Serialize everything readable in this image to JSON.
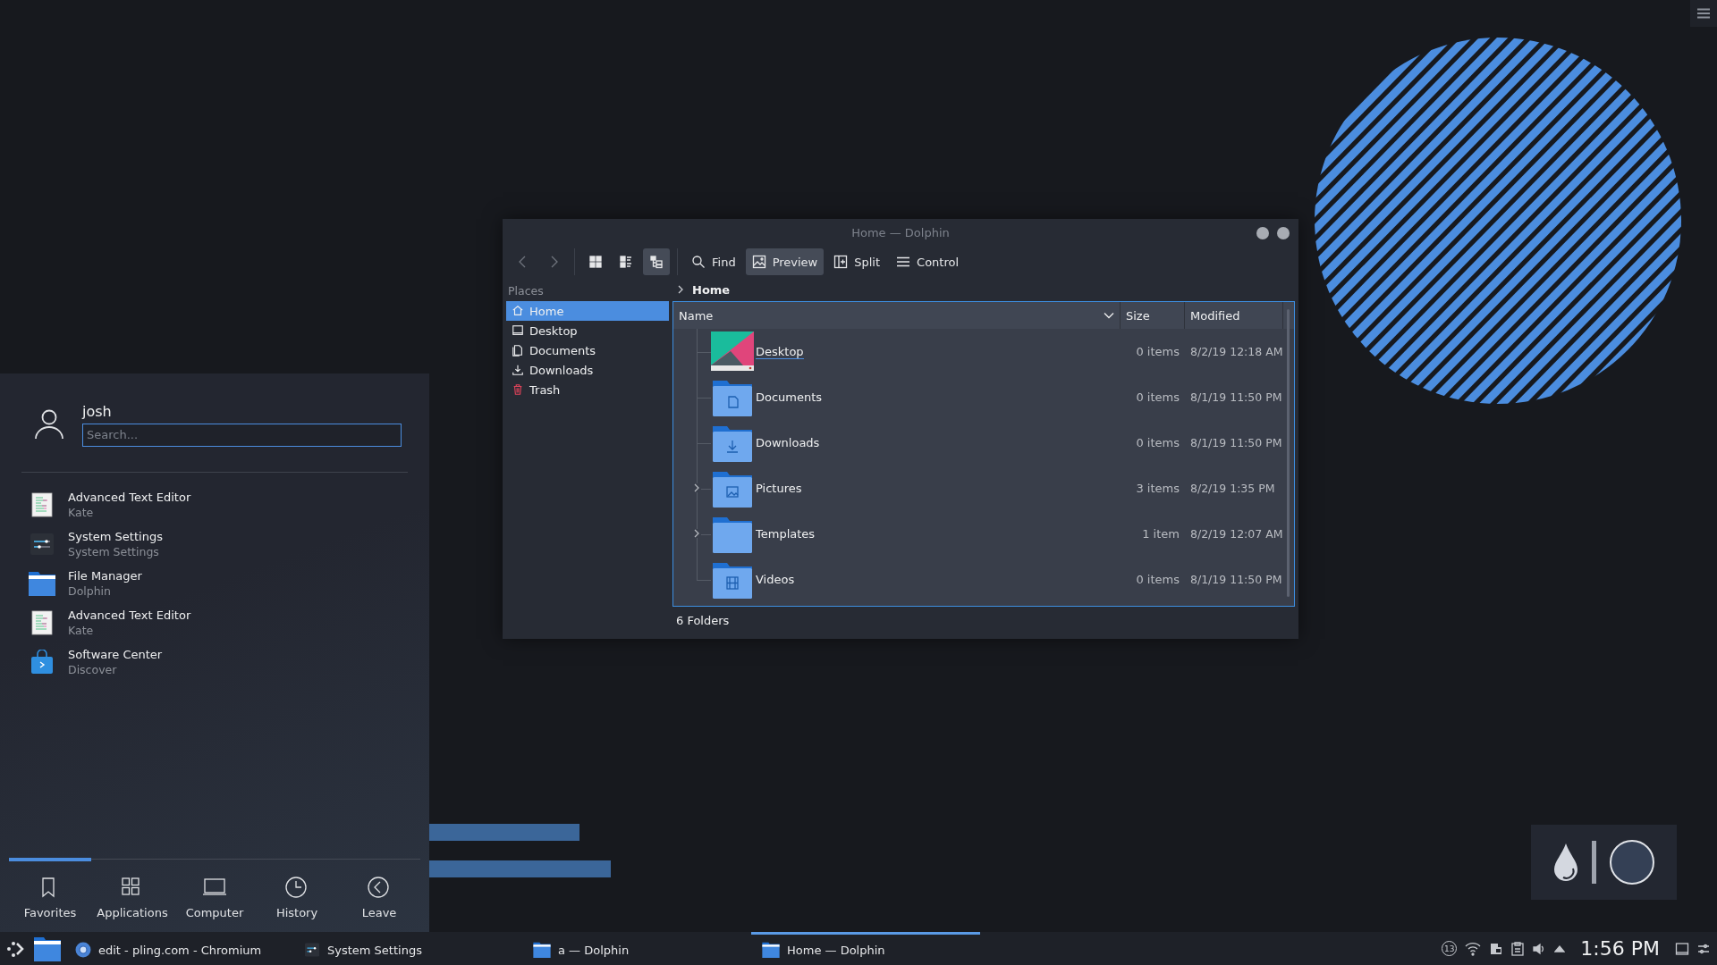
{
  "dolphin": {
    "title": "Home — Dolphin",
    "view_modes": [
      {
        "selected": false
      },
      {
        "selected": false
      },
      {
        "selected": true
      }
    ],
    "toolbar": [
      {
        "kind": "find",
        "label": "Find",
        "selected": false
      },
      {
        "kind": "preview",
        "label": "Preview",
        "selected": true
      },
      {
        "kind": "split",
        "label": "Split",
        "selected": false
      },
      {
        "kind": "control",
        "label": "Control",
        "selected": false
      }
    ],
    "places": {
      "title": "Places",
      "items": [
        {
          "kind": "home",
          "label": "Home",
          "selected": true
        },
        {
          "kind": "desktop",
          "label": "Desktop",
          "selected": false
        },
        {
          "kind": "documents",
          "label": "Documents",
          "selected": false
        },
        {
          "kind": "downloads",
          "label": "Downloads",
          "selected": false
        },
        {
          "kind": "trash",
          "label": "Trash",
          "selected": false
        }
      ]
    },
    "breadcrumb": "Home",
    "columns": [
      "Name",
      "Size",
      "Modified"
    ],
    "rows": [
      {
        "kind": "desktop",
        "name": "Desktop",
        "size": "0 items",
        "modified": "8/2/19 12:18 AM",
        "expandable": false,
        "hovered": true
      },
      {
        "kind": "documents",
        "name": "Documents",
        "size": "0 items",
        "modified": "8/1/19 11:50 PM",
        "expandable": false,
        "hovered": false
      },
      {
        "kind": "downloads",
        "name": "Downloads",
        "size": "0 items",
        "modified": "8/1/19 11:50 PM",
        "expandable": false,
        "hovered": false
      },
      {
        "kind": "pictures",
        "name": "Pictures",
        "size": "3 items",
        "modified": "8/2/19 1:35 PM",
        "expandable": true,
        "hovered": false
      },
      {
        "kind": "templates",
        "name": "Templates",
        "size": "1 item",
        "modified": "8/2/19 12:07 AM",
        "expandable": true,
        "hovered": false
      },
      {
        "kind": "videos",
        "name": "Videos",
        "size": "0 items",
        "modified": "8/1/19 11:50 PM",
        "expandable": false,
        "hovered": false
      }
    ],
    "status": "6 Folders"
  },
  "launcher": {
    "user": "josh",
    "search": {
      "placeholder": "Search..."
    },
    "items": [
      {
        "kind": "editor",
        "title": "Advanced Text Editor",
        "subtitle": "Kate"
      },
      {
        "kind": "settings",
        "title": "System Settings",
        "subtitle": "System Settings"
      },
      {
        "kind": "files",
        "title": "File Manager",
        "subtitle": "Dolphin"
      },
      {
        "kind": "editor",
        "title": "Advanced Text Editor",
        "subtitle": "Kate"
      },
      {
        "kind": "store",
        "title": "Software Center",
        "subtitle": "Discover"
      }
    ],
    "tabs": [
      {
        "kind": "favorites",
        "label": "Favorites",
        "selected": true
      },
      {
        "kind": "applications",
        "label": "Applications",
        "selected": false
      },
      {
        "kind": "computer",
        "label": "Computer",
        "selected": false
      },
      {
        "kind": "history",
        "label": "History",
        "selected": false
      },
      {
        "kind": "leave",
        "label": "Leave",
        "selected": false
      }
    ]
  },
  "taskbar": {
    "tasks": [
      {
        "kind": "browser",
        "label": "edit - pling.com - Chromium",
        "selected": false
      },
      {
        "kind": "settings",
        "label": "System Settings",
        "selected": false
      },
      {
        "kind": "files",
        "label": "a — Dolphin",
        "selected": false
      },
      {
        "kind": "files",
        "label": "Home — Dolphin",
        "selected": true
      }
    ],
    "tray_badge": "13",
    "clock": "1:56 PM"
  }
}
